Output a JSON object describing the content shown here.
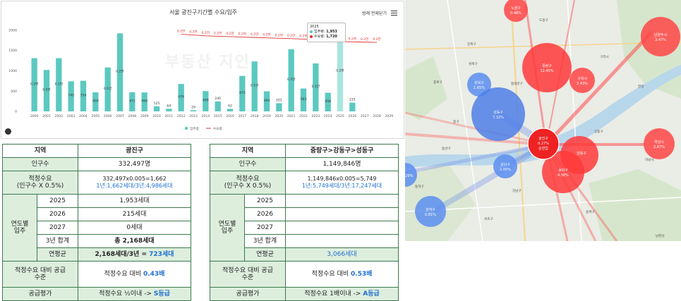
{
  "chart": {
    "title": "서울 광진구기간별 수요/입주",
    "toggle_label": "범례 전체닫기",
    "watermark": "부동산 지인",
    "legend_supply": "입주량",
    "legend_demand": "수요량",
    "tooltip": {
      "year": "2025",
      "supply_label": "입주량",
      "supply_value": "1,953",
      "demand_label": "수요량",
      "demand_value": "1,720"
    }
  },
  "chart_data": {
    "type": "bar",
    "title": "서울 광진구기간별 수요/입주",
    "categories": [
      "2000",
      "2001",
      "2002",
      "2003",
      "2004",
      "2005",
      "2006",
      "2007",
      "2008",
      "2009",
      "2010",
      "2011",
      "2012",
      "2013",
      "2014",
      "2015",
      "2016",
      "2017",
      "2018",
      "2019",
      "2020",
      "2021",
      "2022",
      "2023",
      "2024",
      "2025",
      "2026",
      "2027",
      "2028",
      "2029"
    ],
    "series": [
      {
        "name": "입주량",
        "values": [
          1310,
          1020,
          1310,
          740,
          754,
          469,
          1080,
          1920,
          471,
          466,
          125,
          64,
          676,
          29,
          499,
          245,
          62,
          873,
          1230,
          494,
          201,
          1530,
          563,
          1180,
          458,
          1953,
          215,
          0,
          0,
          0
        ]
      },
      {
        "name": "수요량",
        "values": [
          null,
          null,
          null,
          null,
          null,
          null,
          null,
          null,
          null,
          null,
          null,
          null,
          1900,
          1880,
          1860,
          1850,
          1840,
          1830,
          1820,
          1810,
          1800,
          1790,
          1780,
          1770,
          1760,
          1720,
          1710,
          1705,
          1700,
          null
        ]
      }
    ],
    "bar_labels": [
      "0.2만",
      "0.2만",
      "0.1만",
      "740",
      "754",
      "469",
      "0.1만",
      "0.2만",
      "471",
      "466",
      "125",
      "64",
      "676",
      "29",
      "499",
      "245",
      "62",
      "873",
      "0.1만",
      "494",
      "201",
      "0.2만",
      "563",
      "0.1만",
      "458",
      "0.2만",
      "215",
      "",
      "",
      ""
    ],
    "line_labels": [
      "0.2만",
      "0.2만",
      "0.2만",
      "0.2만",
      "0.2만",
      "0.2만",
      "0.2만",
      "0.2만",
      "0.2만",
      "0.2만",
      "0.2만",
      "0.2만",
      "0.2만",
      "0.2만",
      "0.2만",
      "0.2만",
      "0.2만"
    ],
    "y_ticks": [
      "0",
      "500",
      "1000",
      "1500",
      "2000"
    ],
    "ylim": [
      0,
      2100
    ],
    "highlight_index": 25,
    "colors": {
      "supply": "#5bc9c0",
      "supply_highlight": "#a9e5df",
      "demand": "#e03030"
    },
    "grid": false,
    "legend_position": "bottom"
  },
  "table_left": {
    "col1": "지역",
    "col2": "광진구",
    "pop_label": "인구수",
    "pop_value": "332,497명",
    "need_label1": "적정수요",
    "need_label2": "(인구수 X 0.5%)",
    "need_value1": "332,497x0.005=1,662",
    "need_value2": "1년:1,662세대/3년:4,986세대",
    "yearly_label1": "연도별",
    "yearly_label2": "입주",
    "y1": "2025",
    "y1v": "1,953세대",
    "y2": "2026",
    "y2v": "215세대",
    "y3": "2027",
    "y3v": "0세대",
    "sum_label": "3년 합계",
    "sum_value": "총 2,168세대",
    "avg_label": "연평균",
    "avg_value_a": "2,168세대/3년 = ",
    "avg_value_b": "723세대",
    "ratio_label1": "적정수요 대비 공급",
    "ratio_label2": "수준",
    "ratio_value_a": "적정수요 대비 ",
    "ratio_value_b": "0.43배",
    "eval_label": "공급평가",
    "eval_value_a": "적정수요 ½이내 -> ",
    "eval_value_b": "S등급"
  },
  "table_right": {
    "col1": "지역",
    "col2": "중랑구>강동구>성동구",
    "pop_label": "인구수",
    "pop_value": "1,149,846명",
    "need_label1": "적정수요",
    "need_label2": "(인구수 X 0.5%)",
    "need_value1": "1,149,846x0.005=5,749",
    "need_value2": "1년:5,749세대/3년:17,247세대",
    "yearly_label1": "연도별",
    "yearly_label2": "입주",
    "y1": "2025",
    "y2": "2026",
    "y3": "2027",
    "sum_label": "3년 합계",
    "avg_label": "연평균",
    "avg_value": "3,066세대",
    "ratio_label1": "적정수요 대비 공급",
    "ratio_label2": "수준",
    "ratio_value_a": "적정수요 대비 ",
    "ratio_value_b": "0.53배",
    "eval_label": "공급평가",
    "eval_value_a": "적정수요 1배이내 -> ",
    "eval_value_b": "A등급"
  },
  "map": {
    "center": {
      "name": "광진구",
      "pct": "0.27%",
      "sub": "순전입"
    },
    "bubbles": [
      {
        "name": "노원구",
        "pct": "0.48%",
        "color": "red"
      },
      {
        "name": "중랑구",
        "pct": "12.45%",
        "color": "red"
      },
      {
        "name": "구리시",
        "pct": "2.43%",
        "color": "red"
      },
      {
        "name": "남양주시",
        "pct": "3.47%",
        "color": "red"
      },
      {
        "name": "강동구",
        "pct": "?%",
        "color": "red"
      },
      {
        "name": "송파구",
        "pct": "4.58%",
        "color": "red"
      },
      {
        "name": "하남시",
        "pct": "2.67%",
        "color": "red"
      },
      {
        "name": "성북구",
        "pct": "1.65%",
        "color": "blue"
      },
      {
        "name": "성동구",
        "pct": "7.32%",
        "color": "blue"
      },
      {
        "name": "강남구",
        "pct": "2.05%",
        "color": "blue"
      },
      {
        "name": "관악구",
        "pct": "0.81%",
        "color": "blue"
      },
      {
        "name": "",
        "pct": "29%",
        "color": "blue"
      }
    ],
    "labels": [
      "강북구",
      "도봉구",
      "종로구",
      "동대문구",
      "성북구",
      "중구",
      "용산구",
      "강남구",
      "서초구",
      "동작구",
      "송파구",
      "강동구",
      "하남시",
      "구리시",
      "한강",
      "남한산"
    ]
  }
}
